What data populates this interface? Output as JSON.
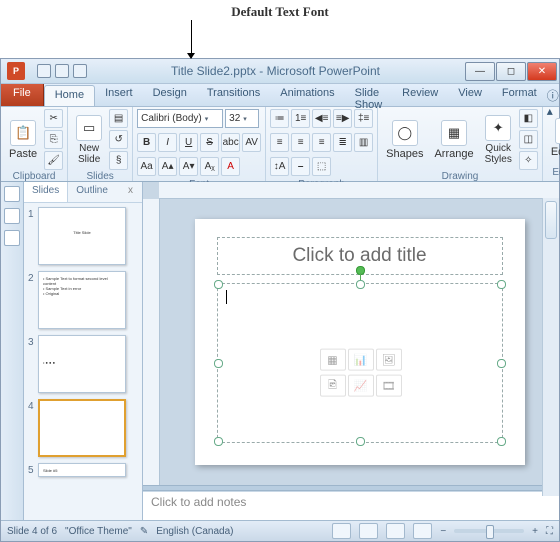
{
  "annotation": "Default Text Font",
  "window": {
    "title": "Title Slide2.pptx - Microsoft PowerPoint",
    "app_letter": "P"
  },
  "tabs": {
    "file": "File",
    "items": [
      "Home",
      "Insert",
      "Design",
      "Transitions",
      "Animations",
      "Slide Show",
      "Review",
      "View",
      "Format"
    ],
    "active": "Home"
  },
  "ribbon": {
    "clipboard": {
      "label": "Clipboard",
      "paste": "Paste"
    },
    "slides": {
      "label": "Slides",
      "new_slide": "New\nSlide"
    },
    "font": {
      "label": "Font",
      "name": "Calibri (Body)",
      "size": "32",
      "bold": "B",
      "italic": "I",
      "underline": "U",
      "strike": "S",
      "shadow": "abc",
      "spacing": "AV",
      "case": "Aa",
      "grow": "A",
      "shrink": "A",
      "clear": "A"
    },
    "paragraph": {
      "label": "Paragraph"
    },
    "drawing": {
      "label": "Drawing",
      "shapes": "Shapes",
      "arrange": "Arrange",
      "quick": "Quick\nStyles"
    },
    "editing": {
      "label": "Editing",
      "edit": "Editing"
    }
  },
  "thumb_tabs": {
    "slides": "Slides",
    "outline": "Outline",
    "close": "x"
  },
  "thumbs": [
    {
      "num": "1",
      "text": "Title Slide"
    },
    {
      "num": "2",
      "text": "• Sample Text to format second level content\n• Sample Text in error\n• Original"
    },
    {
      "num": "3",
      "text": "• ● ● ●"
    },
    {
      "num": "4",
      "text": ""
    },
    {
      "num": "5",
      "text": "Slide #5"
    }
  ],
  "slide": {
    "title_placeholder": "Click to add title"
  },
  "content_icons": [
    "▦",
    "📊",
    "🖼",
    "🖻",
    "📈",
    "🎞"
  ],
  "notes_placeholder": "Click to add notes",
  "status": {
    "slide_info": "Slide 4 of 6",
    "theme": "\"Office Theme\"",
    "lang": "English (Canada)",
    "zoom_minus": "−",
    "zoom_plus": "+",
    "fit": "⛶"
  }
}
